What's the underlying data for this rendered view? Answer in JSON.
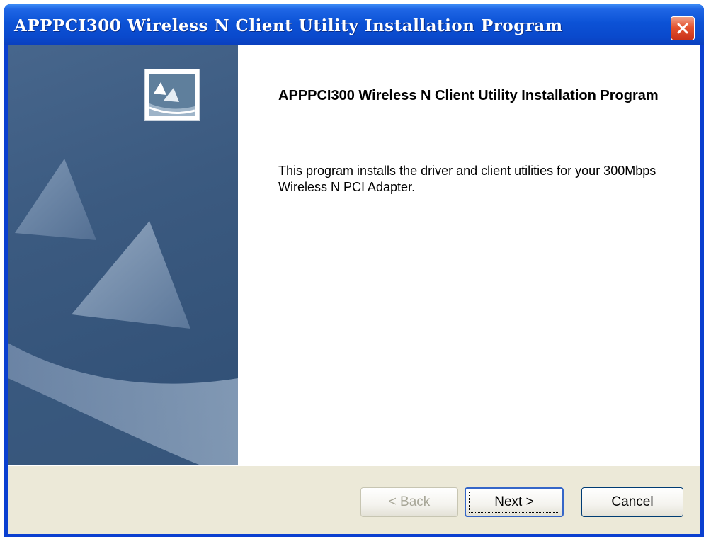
{
  "window": {
    "title": "APPPCI300 Wireless N Client Utility Installation Program"
  },
  "content": {
    "heading": "APPPCI300 Wireless N Client Utility Installation Program",
    "description": "This program installs the driver and client utilities for your 300Mbps Wireless N PCI Adapter."
  },
  "buttons": {
    "back_label": "< Back",
    "next_label": "Next >",
    "cancel_label": "Cancel"
  },
  "icons": {
    "close": "close-icon",
    "logo": "sail-logo-icon"
  },
  "colors": {
    "titlebar": "#0a49cc",
    "close_button": "#e4532f",
    "dialog_face": "#ece9d8",
    "banner": "#3b5a80"
  }
}
